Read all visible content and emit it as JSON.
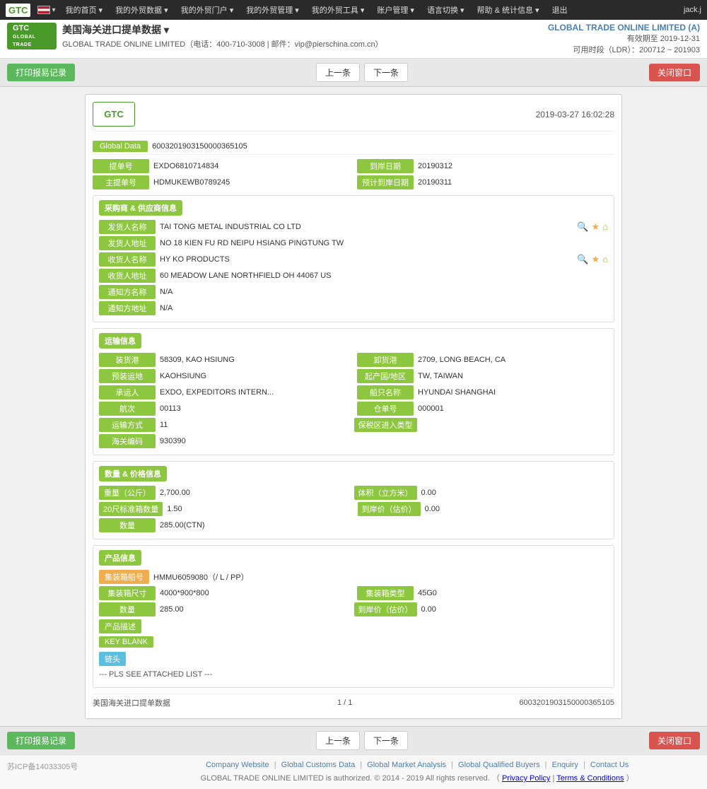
{
  "nav": {
    "logo": "GTC",
    "items": [
      {
        "label": "我的首页 ▾"
      },
      {
        "label": "我的外贸数据 ▾"
      },
      {
        "label": "我的外贸门户 ▾"
      },
      {
        "label": "我的外贸管理 ▾"
      },
      {
        "label": "我的外贸工具 ▾"
      },
      {
        "label": "账户管理 ▾"
      },
      {
        "label": "语言切换 ▾"
      },
      {
        "label": "帮助 & 统计信息 ▾"
      },
      {
        "label": "退出"
      }
    ],
    "user": "jack.j"
  },
  "header": {
    "flag": "US",
    "title": "美国海关进口提单数据 ▾",
    "contact": "GLOBAL TRADE ONLINE LIMITED（电话：400-710-3008 | 邮件：vip@pierschina.com.cn）",
    "company_name": "GLOBAL TRADE ONLINE LIMITED (A)",
    "valid_until": "有效期至 2019-12-31",
    "ldr": "可用时段（LDR）：200712 ~ 201903"
  },
  "toolbar": {
    "print_btn": "打印报易记录",
    "prev_btn": "上一条",
    "next_btn": "下一条",
    "close_btn": "关闭窗口"
  },
  "record": {
    "datetime": "2019-03-27 16:02:28",
    "global_data_label": "Global Data",
    "global_data_value": "6003201903150000365105",
    "bill_no_label": "提单号",
    "bill_no_value": "EXDO6810714834",
    "arrival_date_label": "到岸日期",
    "arrival_date_value": "20190312",
    "master_bill_label": "主提单号",
    "master_bill_value": "HDMUKEWB0789245",
    "est_arrival_label": "预计到岸日期",
    "est_arrival_value": "20190311"
  },
  "buyer_supplier": {
    "section_title": "采购商 & 供应商信息",
    "shipper_name_label": "发货人名称",
    "shipper_name_value": "TAI TONG METAL INDUSTRIAL CO LTD",
    "shipper_addr_label": "发货人地址",
    "shipper_addr_value": "NO 18 KIEN FU RD NEIPU HSIANG PINGTUNG TW",
    "consignee_name_label": "收货人名称",
    "consignee_name_value": "HY KO PRODUCTS",
    "consignee_addr_label": "收货人地址",
    "consignee_addr_value": "60 MEADOW LANE NORTHFIELD OH 44067 US",
    "notify_name_label": "通知方名称",
    "notify_name_value": "N/A",
    "notify_addr_label": "通知方地址",
    "notify_addr_value": "N/A"
  },
  "transport": {
    "section_title": "运输信息",
    "load_port_label": "装货港",
    "load_port_value": "58309, KAO HSIUNG",
    "discharge_port_label": "卸货港",
    "discharge_port_value": "2709, LONG BEACH, CA",
    "load_place_label": "预装运地",
    "load_place_value": "KAOHSIUNG",
    "origin_label": "起产国/地区",
    "origin_value": "TW, TAIWAN",
    "carrier_label": "承运人",
    "carrier_value": "EXDO, EXPEDITORS INTERN...",
    "vessel_label": "船只名称",
    "vessel_value": "HYUNDAI SHANGHAI",
    "voyage_label": "航次",
    "voyage_value": "00113",
    "container_no_label": "仓单号",
    "container_no_value": "000001",
    "transport_mode_label": "运输方式",
    "transport_mode_value": "11",
    "bonded_label": "保税区进入类型",
    "bonded_value": "",
    "customs_code_label": "海关编码",
    "customs_code_value": "930390"
  },
  "quantity_price": {
    "section_title": "数量 & 价格信息",
    "weight_label": "重量（公斤）",
    "weight_value": "2,700.00",
    "volume_label": "体积（立方米）",
    "volume_value": "0.00",
    "container_20_label": "20尺标准箱数量",
    "container_20_value": "1.50",
    "arrival_price_label": "到岸价（估价）",
    "arrival_price_value": "0.00",
    "quantity_label": "数量",
    "quantity_value": "285.00(CTN)"
  },
  "product_info": {
    "section_title": "产品信息",
    "container_no_label": "集装箱船号",
    "container_no_value": "HMMU6059080（/ L / PP）",
    "container_size_label": "集装箱尺寸",
    "container_size_value": "4000*900*800",
    "container_type_label": "集装箱类型",
    "container_type_value": "45G0",
    "quantity_label": "数量",
    "quantity_value": "285.00",
    "delivery_price_label": "到岸价（估价）",
    "delivery_price_value": "0.00",
    "product_desc_label": "产品描述",
    "keyword_label": "KEY BLANK",
    "anchor_label": "链头",
    "product_text": "--- PLS SEE ATTACHED LIST ---"
  },
  "bottom_info": {
    "page_label": "美国海关进口提单数据",
    "page_num": "1 / 1",
    "record_id": "6003201903150000365105"
  },
  "footer": {
    "icp": "苏ICP备14033305号",
    "links": [
      "Company Website",
      "Global Customs Data",
      "Global Market Analysis",
      "Global Qualified Buyers",
      "Enquiry",
      "Contact Us"
    ],
    "copyright": "GLOBAL TRADE ONLINE LIMITED is authorized. © 2014 - 2019 All rights reserved.",
    "policy_links": [
      "Privacy Policy",
      "Terms & Conditions"
    ]
  }
}
